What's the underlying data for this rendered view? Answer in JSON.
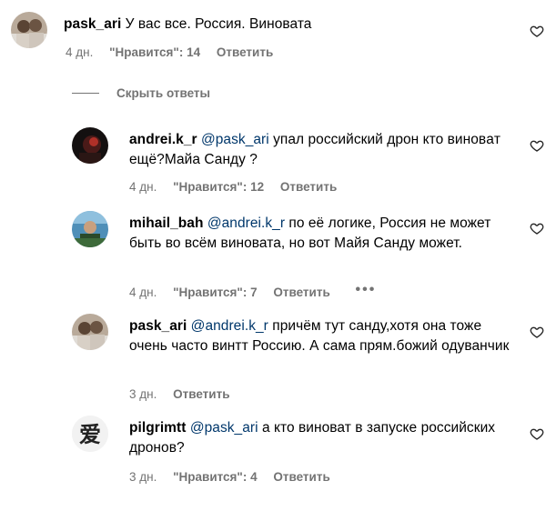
{
  "comments": [
    {
      "username": "pask_ari",
      "mention": "",
      "text": "У вас все. Россия. Виновата",
      "time": "4 дн.",
      "likes": "\"Нравится\": 14",
      "reply": "Ответить"
    },
    {
      "username": "andrei.k_r",
      "mention": "@pask_ari",
      "text": "упал российский дрон кто виновaт ещё?Майа Санду ?",
      "time": "4 дн.",
      "likes": "\"Нравится\": 12",
      "reply": "Ответить"
    },
    {
      "username": "mihail_bah",
      "mention": "@andrei.k_r",
      "text": "по её логике, Россия не может быть во всём виновата, но вот Майя Санду может.",
      "time": "4 дн.",
      "likes": "\"Нравится\": 7",
      "reply": "Ответить",
      "more": "•••"
    },
    {
      "username": "pask_ari",
      "mention": "@andrei.k_r",
      "text": "причём тут санду,хотя она тоже очень часто винтт Россию. А сама прям.божий одуванчик",
      "time": "3 дн.",
      "likes": "",
      "reply": "Ответить"
    },
    {
      "username": "pilgrimtt",
      "mention": "@pask_ari",
      "text": "а кто виноват в запуске российских дронов?",
      "time": "3 дн.",
      "likes": "\"Нравится\": 4",
      "reply": "Ответить"
    }
  ],
  "hide_replies": "Скрыть ответы",
  "icons": {
    "like": "heart-outline-icon",
    "avatar": "profile-avatar"
  },
  "colors": {
    "text": "#000000",
    "secondary": "#737373",
    "mention": "#00376b"
  }
}
